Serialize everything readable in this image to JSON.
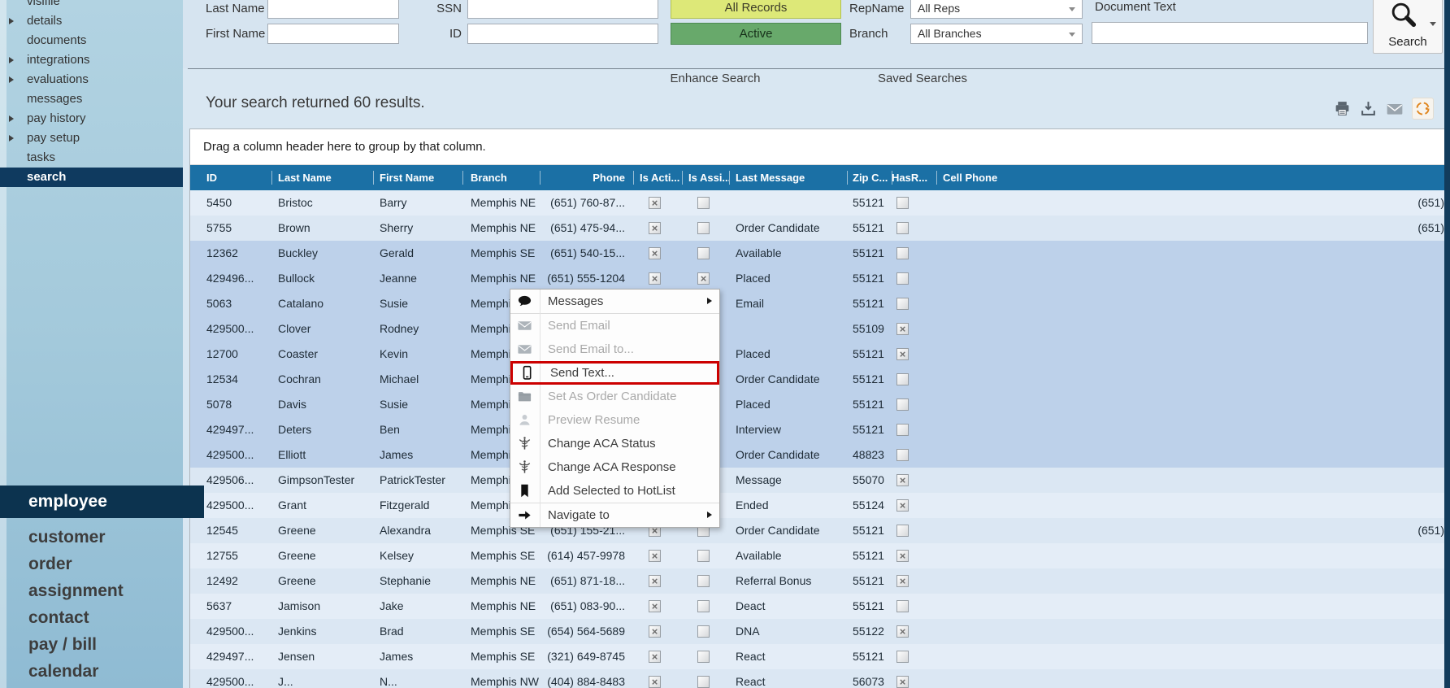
{
  "colors": {
    "header_blue": "#1b70a5",
    "selected_navy": "#0f3a5f",
    "all_records_yellow": "#dde878",
    "active_green": "#68a96b",
    "highlight_red": "#cc0000",
    "orange_icon": "#e0861f",
    "selected_row_blue": "#bdd1ea"
  },
  "sidebar": {
    "top_items": [
      {
        "label": "visifile",
        "arrow": false,
        "selected": false
      },
      {
        "label": "details",
        "arrow": true,
        "selected": false
      },
      {
        "label": "documents",
        "arrow": false,
        "selected": false
      },
      {
        "label": "integrations",
        "arrow": true,
        "selected": false
      },
      {
        "label": "evaluations",
        "arrow": true,
        "selected": false
      },
      {
        "label": "messages",
        "arrow": false,
        "selected": false
      },
      {
        "label": "pay history",
        "arrow": true,
        "selected": false
      },
      {
        "label": "pay setup",
        "arrow": true,
        "selected": false
      },
      {
        "label": "tasks",
        "arrow": false,
        "selected": false
      },
      {
        "label": "search",
        "arrow": false,
        "selected": true
      }
    ],
    "bottom_items": [
      {
        "label": "employee",
        "selected": true
      },
      {
        "label": "customer",
        "selected": false
      },
      {
        "label": "order",
        "selected": false
      },
      {
        "label": "assignment",
        "selected": false
      },
      {
        "label": "contact",
        "selected": false
      },
      {
        "label": "pay / bill",
        "selected": false
      },
      {
        "label": "calendar",
        "selected": false
      }
    ]
  },
  "search_form": {
    "last_name": {
      "label": "Last Name",
      "value": "",
      "placeholder": ""
    },
    "first_name": {
      "label": "First Name",
      "value": "",
      "placeholder": ""
    },
    "ssn": {
      "label": "SSN",
      "value": "",
      "placeholder": ""
    },
    "id": {
      "label": "ID",
      "value": "",
      "placeholder": ""
    },
    "all_records_button": "All Records",
    "active_button": "Active",
    "rep_dropdown": {
      "label": "RepName",
      "value": "All Reps"
    },
    "branch_dropdown": {
      "label": "Branch",
      "value": "All Branches"
    },
    "document_text": {
      "label": "Document Text",
      "value": "",
      "placeholder": ""
    },
    "search_button": "Search"
  },
  "links": {
    "enhance": "Enhance Search",
    "saved": "Saved Searches"
  },
  "results": {
    "summary": "Your search returned 60 results.",
    "group_hint": "Drag a column header here to group by that column.",
    "toolbar_icons": [
      "print-icon",
      "export-icon",
      "email-icon",
      "orange-ring-icon"
    ]
  },
  "grid": {
    "columns": [
      "ID",
      "Last Name",
      "First Name",
      "Branch",
      "Phone",
      "Is Acti...",
      "Is Assi...",
      "Last Message",
      "Zip C...",
      "HasR...",
      "Cell Phone"
    ],
    "rows": [
      {
        "id": "5450",
        "last": "Bristoc",
        "first": "Barry",
        "branch": "Memphis NE",
        "phone": "(651) 760-87...",
        "is_acti": true,
        "is_assi": false,
        "last_message": "",
        "zip": "55121",
        "hasr": false,
        "cell": "(651)",
        "selected": false
      },
      {
        "id": "5755",
        "last": "Brown",
        "first": "Sherry",
        "branch": "Memphis NE",
        "phone": "(651) 475-94...",
        "is_acti": true,
        "is_assi": false,
        "last_message": "Order Candidate",
        "zip": "55121",
        "hasr": false,
        "cell": "(651)",
        "selected": false
      },
      {
        "id": "12362",
        "last": "Buckley",
        "first": "Gerald",
        "branch": "Memphis SE",
        "phone": "(651) 540-15...",
        "is_acti": true,
        "is_assi": false,
        "last_message": "Available",
        "zip": "55121",
        "hasr": false,
        "cell": "",
        "selected": true
      },
      {
        "id": "429496...",
        "last": "Bullock",
        "first": "Jeanne",
        "branch": "Memphis NE",
        "phone": "(651) 555-1204",
        "is_acti": true,
        "is_assi": true,
        "last_message": "Placed",
        "zip": "55121",
        "hasr": false,
        "cell": "",
        "selected": true
      },
      {
        "id": "5063",
        "last": "Catalano",
        "first": "Susie",
        "branch": "Memphis",
        "phone": "",
        "is_acti": true,
        "is_assi": false,
        "last_message": "Email",
        "zip": "55121",
        "hasr": false,
        "cell": "",
        "selected": true
      },
      {
        "id": "429500...",
        "last": "Clover",
        "first": "Rodney",
        "branch": "Memphis",
        "phone": "",
        "is_acti": true,
        "is_assi": false,
        "last_message": "",
        "zip": "55109",
        "hasr": true,
        "cell": "",
        "selected": true
      },
      {
        "id": "12700",
        "last": "Coaster",
        "first": "Kevin",
        "branch": "Memphis",
        "phone": "",
        "is_acti": true,
        "is_assi": false,
        "last_message": "Placed",
        "zip": "55121",
        "hasr": true,
        "cell": "",
        "selected": true
      },
      {
        "id": "12534",
        "last": "Cochran",
        "first": "Michael",
        "branch": "Memphis",
        "phone": "",
        "is_acti": true,
        "is_assi": false,
        "last_message": "Order Candidate",
        "zip": "55121",
        "hasr": false,
        "cell": "",
        "selected": true
      },
      {
        "id": "5078",
        "last": "Davis",
        "first": "Susie",
        "branch": "Memphis",
        "phone": "",
        "is_acti": true,
        "is_assi": false,
        "last_message": "Placed",
        "zip": "55121",
        "hasr": false,
        "cell": "",
        "selected": true
      },
      {
        "id": "429497...",
        "last": "Deters",
        "first": "Ben",
        "branch": "Memphis",
        "phone": "",
        "is_acti": true,
        "is_assi": false,
        "last_message": "Interview",
        "zip": "55121",
        "hasr": false,
        "cell": "",
        "selected": true
      },
      {
        "id": "429500...",
        "last": "Elliott",
        "first": "James",
        "branch": "Memphis",
        "phone": "",
        "is_acti": true,
        "is_assi": false,
        "last_message": "Order Candidate",
        "zip": "48823",
        "hasr": false,
        "cell": "",
        "selected": true
      },
      {
        "id": "429506...",
        "last": "GimpsonTester",
        "first": "PatrickTester",
        "branch": "Memphis",
        "phone": "",
        "is_acti": true,
        "is_assi": false,
        "last_message": "Message",
        "zip": "55070",
        "hasr": true,
        "cell": "",
        "selected": false
      },
      {
        "id": "429500...",
        "last": "Grant",
        "first": "Fitzgerald",
        "branch": "Memphis",
        "phone": "",
        "is_acti": true,
        "is_assi": false,
        "last_message": "Ended",
        "zip": "55124",
        "hasr": true,
        "cell": "",
        "selected": false
      },
      {
        "id": "12545",
        "last": "Greene",
        "first": "Alexandra",
        "branch": "Memphis SE",
        "phone": "(651) 155-21...",
        "is_acti": true,
        "is_assi": false,
        "last_message": "Order Candidate",
        "zip": "55121",
        "hasr": false,
        "cell": "(651)",
        "selected": false
      },
      {
        "id": "12755",
        "last": "Greene",
        "first": "Kelsey",
        "branch": "Memphis SE",
        "phone": "(614) 457-9978",
        "is_acti": true,
        "is_assi": false,
        "last_message": "Available",
        "zip": "55121",
        "hasr": true,
        "cell": "",
        "selected": false
      },
      {
        "id": "12492",
        "last": "Greene",
        "first": "Stephanie",
        "branch": "Memphis NE",
        "phone": "(651) 871-18...",
        "is_acti": true,
        "is_assi": false,
        "last_message": "Referral Bonus",
        "zip": "55121",
        "hasr": true,
        "cell": "",
        "selected": false
      },
      {
        "id": "5637",
        "last": "Jamison",
        "first": "Jake",
        "branch": "Memphis NE",
        "phone": "(651) 083-90...",
        "is_acti": true,
        "is_assi": false,
        "last_message": "Deact",
        "zip": "55121",
        "hasr": false,
        "cell": "",
        "selected": false
      },
      {
        "id": "429500...",
        "last": "Jenkins",
        "first": "Brad",
        "branch": "Memphis SE",
        "phone": "(654) 564-5689",
        "is_acti": true,
        "is_assi": false,
        "last_message": "DNA",
        "zip": "55122",
        "hasr": true,
        "cell": "",
        "selected": false
      },
      {
        "id": "429497...",
        "last": "Jensen",
        "first": "James",
        "branch": "Memphis SE",
        "phone": "(321) 649-8745",
        "is_acti": true,
        "is_assi": false,
        "last_message": "React",
        "zip": "55121",
        "hasr": false,
        "cell": "",
        "selected": false
      },
      {
        "id": "429500...",
        "last": "J...",
        "first": "N...",
        "branch": "Memphis NW",
        "phone": "(404) 884-8483",
        "is_acti": true,
        "is_assi": false,
        "last_message": "React",
        "zip": "56073",
        "hasr": true,
        "cell": "",
        "selected": false
      }
    ]
  },
  "context_menu": {
    "items": [
      {
        "label": "Messages",
        "icon": "messages-icon",
        "enabled": true,
        "submenu": true,
        "highlight": false,
        "sep_after": true
      },
      {
        "label": "Send Email",
        "icon": "email-icon",
        "enabled": false,
        "submenu": false,
        "highlight": false
      },
      {
        "label": "Send Email to...",
        "icon": "email-icon",
        "enabled": false,
        "submenu": false,
        "highlight": false
      },
      {
        "label": "Send Text...",
        "icon": "phone-icon",
        "enabled": true,
        "submenu": false,
        "highlight": true
      },
      {
        "label": "Set As Order Candidate",
        "icon": "folder-icon",
        "enabled": false,
        "submenu": false,
        "highlight": false
      },
      {
        "label": "Preview Resume",
        "icon": "resume-icon",
        "enabled": false,
        "submenu": false,
        "highlight": false
      },
      {
        "label": "Change ACA Status",
        "icon": "caduceus-icon",
        "enabled": true,
        "submenu": false,
        "highlight": false
      },
      {
        "label": "Change ACA Response",
        "icon": "caduceus-icon",
        "enabled": true,
        "submenu": false,
        "highlight": false
      },
      {
        "label": "Add Selected to HotList",
        "icon": "bookmark-icon",
        "enabled": true,
        "submenu": false,
        "highlight": false
      },
      {
        "label": "Navigate to",
        "icon": "navigate-arrow-icon",
        "enabled": true,
        "submenu": true,
        "highlight": false,
        "sep_before": true
      }
    ]
  }
}
